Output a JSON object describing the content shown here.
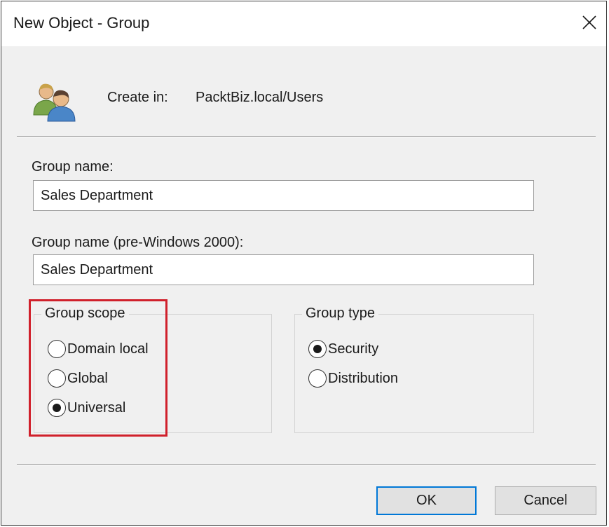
{
  "window": {
    "title": "New Object - Group",
    "close_symbol": "✕"
  },
  "header": {
    "icon": "users-group-icon",
    "create_in_label": "Create in:",
    "create_in_path": "PacktBiz.local/Users"
  },
  "form": {
    "group_name_label": "Group name:",
    "group_name_value": "Sales Department",
    "group_name_pre2000_label": "Group name (pre-Windows 2000):",
    "group_name_pre2000_value": "Sales Department"
  },
  "group_scope": {
    "legend": "Group scope",
    "options": [
      {
        "label": "Domain local",
        "checked": false
      },
      {
        "label": "Global",
        "checked": false
      },
      {
        "label": "Universal",
        "checked": true
      }
    ]
  },
  "group_type": {
    "legend": "Group type",
    "options": [
      {
        "label": "Security",
        "checked": true
      },
      {
        "label": "Distribution",
        "checked": false
      }
    ]
  },
  "buttons": {
    "ok_label": "OK",
    "cancel_label": "Cancel"
  },
  "colors": {
    "highlight": "#d0202b",
    "default_button_border": "#0078d7",
    "dialog_background": "#f0f0f0"
  }
}
